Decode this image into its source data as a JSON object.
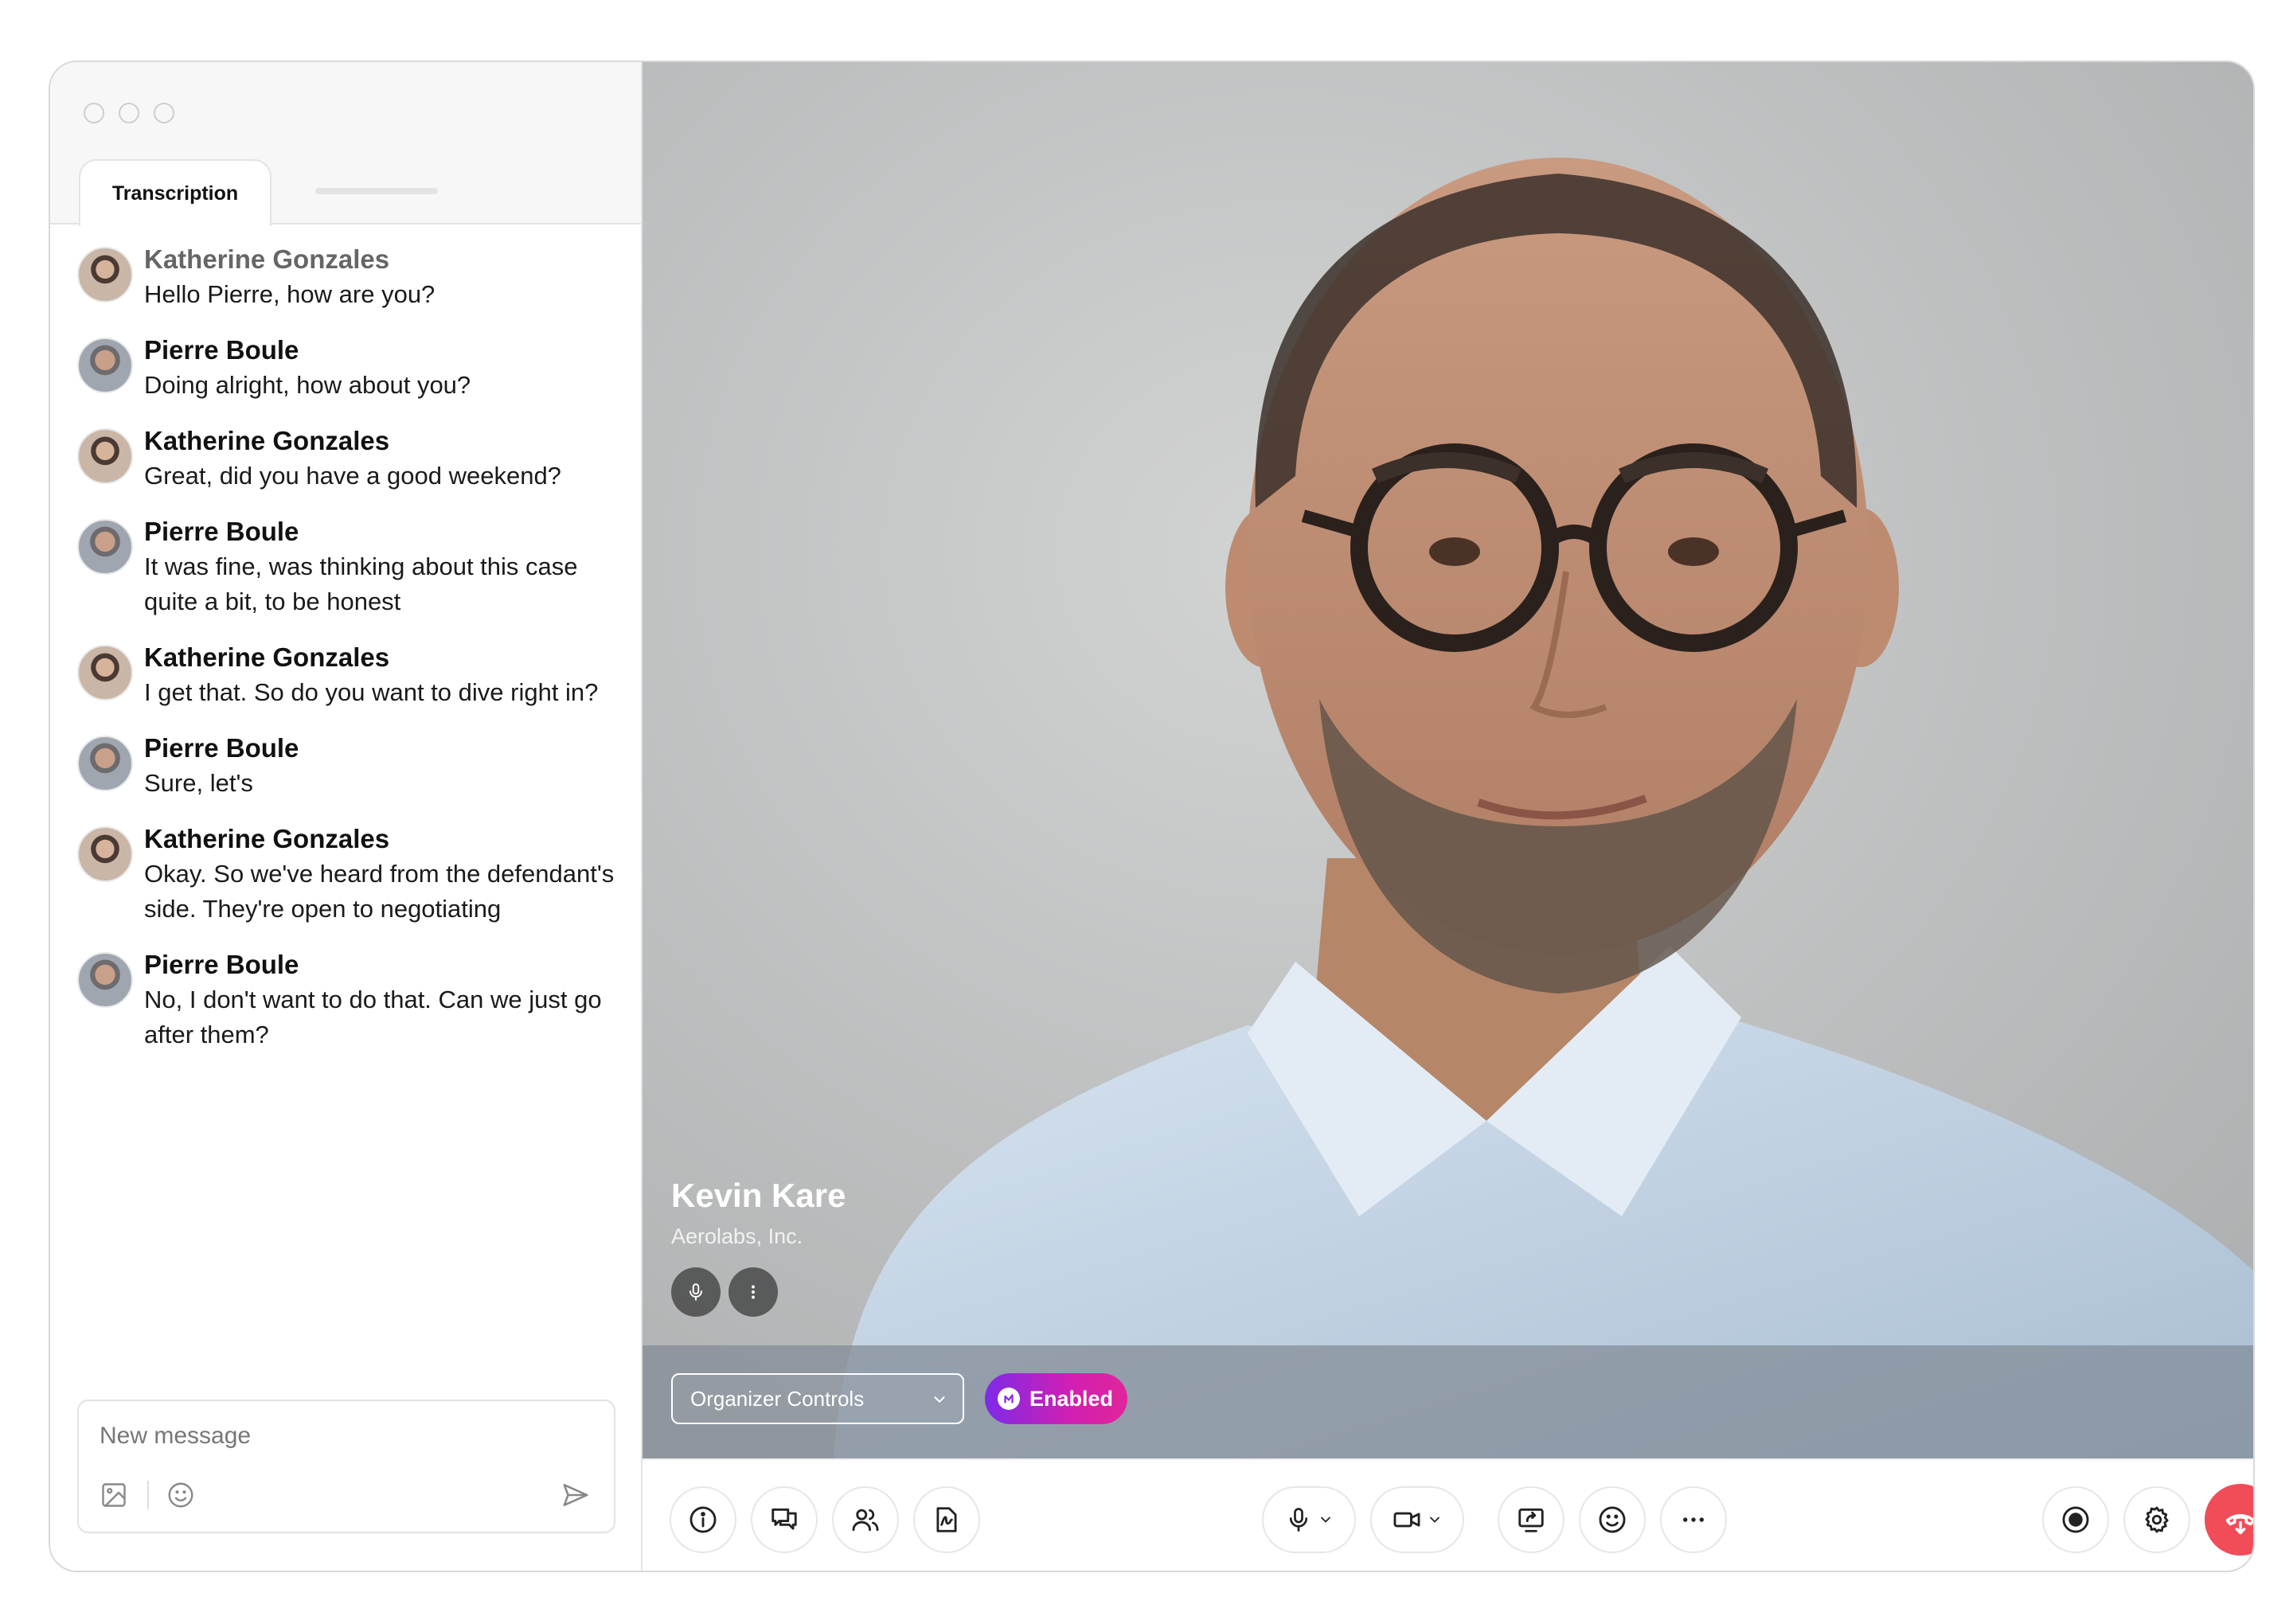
{
  "sidebar": {
    "tabs": [
      {
        "label": "Transcription"
      }
    ],
    "messages": [
      {
        "name": "Katherine Gonzales",
        "text": "Hello Pierre, how are you?"
      },
      {
        "name": "Pierre Boule",
        "text": "Doing alright, how about you?"
      },
      {
        "name": "Katherine Gonzales",
        "text": "Great, did you have a good weekend?"
      },
      {
        "name": "Pierre Boule",
        "text": "It was fine, was thinking about this case quite a bit, to be honest"
      },
      {
        "name": "Katherine Gonzales",
        "text": "I get that. So do you want to dive right in?"
      },
      {
        "name": "Pierre Boule",
        "text": "Sure, let's"
      },
      {
        "name": "Katherine Gonzales",
        "text": "Okay. So we've heard from the defendant's side. They're open to negotiating"
      },
      {
        "name": "Pierre Boule",
        "text": "No, I don't want to do that. Can we just go after them?"
      }
    ],
    "composer": {
      "placeholder": "New message"
    }
  },
  "video": {
    "participant_name": "Kevin Kare",
    "participant_org": "Aerolabs, Inc.",
    "organizer_controls_label": "Organizer Controls",
    "badge_label": "Enabled"
  },
  "colors": {
    "end_call": "#f04d58",
    "badge_start": "#7d2ae8",
    "badge_end": "#e0259a"
  }
}
